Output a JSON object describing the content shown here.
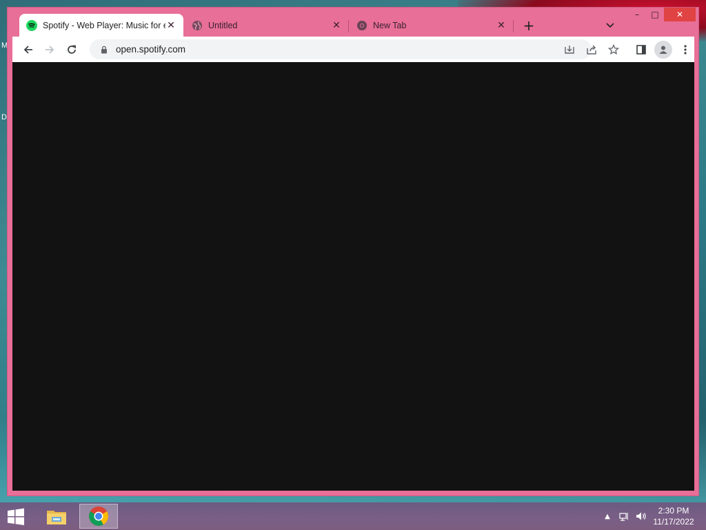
{
  "desktop": {
    "edge_labels": [
      "M",
      "D"
    ]
  },
  "browser": {
    "tabs": [
      {
        "title": "Spotify - Web Player: Music for e",
        "icon": "spotify-icon",
        "active": true
      },
      {
        "title": "Untitled",
        "icon": "globe-icon",
        "active": false
      },
      {
        "title": "New Tab",
        "icon": "chrome-icon",
        "active": false
      }
    ],
    "new_tab_symbol": "+",
    "window_controls": {
      "minimize": "–",
      "maximize": "□",
      "close": "✕"
    },
    "toolbar": {
      "url": "open.spotify.com",
      "icons": [
        "back-arrow-icon",
        "forward-arrow-icon",
        "reload-icon",
        "lock-icon",
        "install-icon",
        "share-icon",
        "bookmark-star-icon",
        "side-panel-icon",
        "profile-icon",
        "menu-dots-icon"
      ]
    },
    "content_background": "#121212"
  },
  "taskbar": {
    "clock_time": "2:30 PM",
    "clock_date": "11/17/2022",
    "apps": [
      "file-explorer-icon",
      "chrome-icon"
    ]
  },
  "colors": {
    "window_frame": "#e86f97",
    "spotify_green": "#1ed760",
    "close_red": "#e04343"
  }
}
